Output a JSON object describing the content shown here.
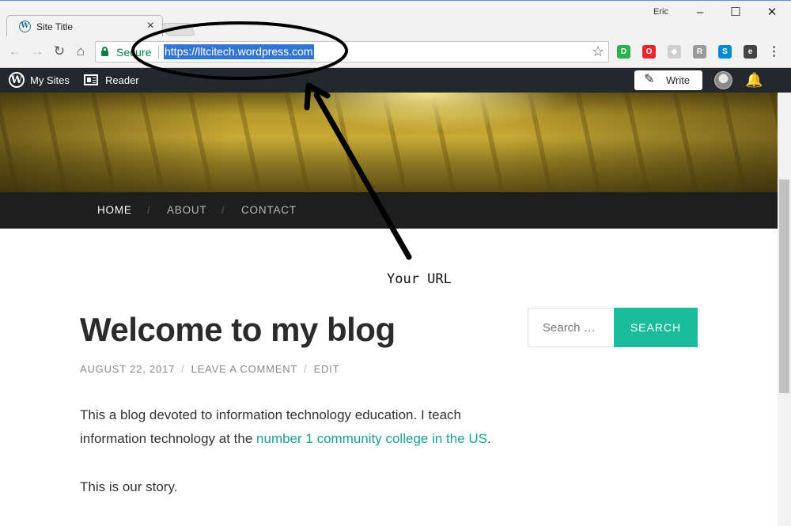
{
  "browser": {
    "tab_title": "Site Title",
    "tab_close": "×",
    "profile_name": "Eric",
    "window_controls": {
      "minimize": "–",
      "maximize": "☐",
      "close": "✕"
    },
    "nav": {
      "back": "←",
      "forward": "→",
      "reload": "↻",
      "home": "⌂"
    },
    "secure_label": "Secure",
    "url": "https://lltcitech.wordpress.com",
    "star_icon": "☆",
    "extensions": [
      {
        "name": "readability-ext-icon",
        "glyph": "D",
        "color": "#2bb24c"
      },
      {
        "name": "opera-ext-icon",
        "glyph": "O",
        "color": "#e8262d"
      },
      {
        "name": "shield-ext-icon",
        "glyph": "◆",
        "color": "#cfcfcf"
      },
      {
        "name": "tool-ext-icon",
        "glyph": "R",
        "color": "#9a9a9a"
      },
      {
        "name": "skype-ext-icon",
        "glyph": "S",
        "color": "#0088d1"
      },
      {
        "name": "evernote-ext-icon",
        "glyph": "e",
        "color": "#444444"
      },
      {
        "name": "menu-icon",
        "glyph": "⋮",
        "color": "#f2f2f2"
      }
    ]
  },
  "wpbar": {
    "my_sites": "My Sites",
    "reader": "Reader",
    "write": "Write",
    "pencil_icon": "✎",
    "bell_icon": "🔔",
    "logo_glyph": "W"
  },
  "site": {
    "nav": [
      "HOME",
      "ABOUT",
      "CONTACT"
    ],
    "nav_separator": "/"
  },
  "post": {
    "title": "Welcome to my blog",
    "meta": [
      "AUGUST 22, 2017",
      "LEAVE A COMMENT",
      "EDIT"
    ],
    "meta_separator": "/",
    "p1_before": "This a blog devoted to information technology education. I teach information technology at the ",
    "p1_link": "number 1 community college in the US",
    "p1_after": ".",
    "p2": "This is our story."
  },
  "sidebar": {
    "search_placeholder": "Search …",
    "search_button": "SEARCH"
  },
  "annotation": {
    "label": "Your URL"
  },
  "colors": {
    "accent": "#1abc9c",
    "link": "#1aa188",
    "admin_bar": "#23282d",
    "url_highlight": "#3276d2"
  }
}
